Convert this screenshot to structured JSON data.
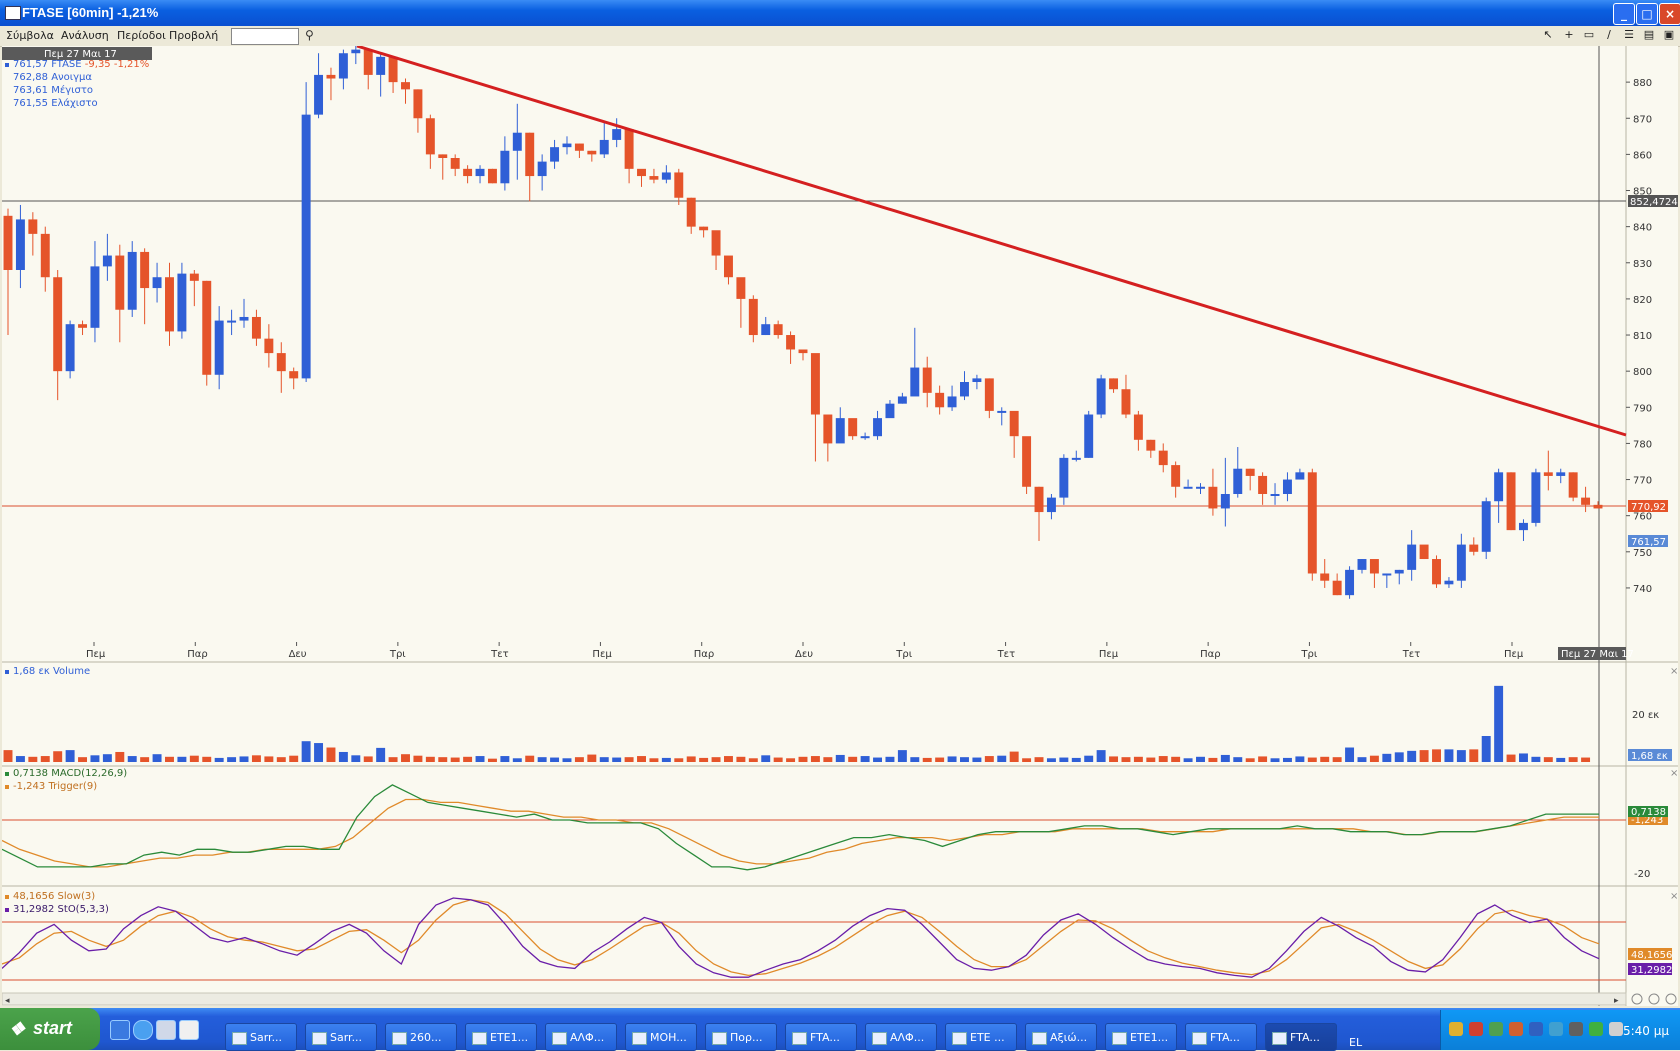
{
  "window": {
    "title": "FTASE [60min] -1,21%",
    "buttons": [
      "_",
      "□",
      "×"
    ]
  },
  "menu": {
    "items": [
      "Σύμβολα",
      "Ανάλυση",
      "Περίοδοι",
      "Προβολή"
    ],
    "search_value": ""
  },
  "toolbar": {
    "tools": [
      "arrow-icon",
      "crosshair-icon",
      "rect-icon",
      "line-icon",
      "hline-icon",
      "panel-icon",
      "save-icon"
    ]
  },
  "price_panel": {
    "date_badge": "Πεμ 27 Μαι 17",
    "info": {
      "symbol_line_value": "761,57",
      "symbol": "FTASE",
      "change": "-9,35",
      "change_pct": "-1,21%",
      "open_label": "Ανοιγμα",
      "open": "762,88",
      "high_label": "Μέγιστο",
      "high": "763,61",
      "low_label": "Ελάχιστο",
      "low": "761,55"
    },
    "y_ticks": [
      "880",
      "870",
      "860",
      "850",
      "840",
      "830",
      "820",
      "810",
      "800",
      "790",
      "780",
      "770",
      "760",
      "750",
      "740"
    ],
    "x_ticks": [
      "Πεμ",
      "Παρ",
      "Δευ",
      "Τρι",
      "Τετ",
      "Πεμ",
      "Παρ",
      "Δευ",
      "Τρι",
      "Τετ",
      "Πεμ",
      "Παρ",
      "Τρι",
      "Τετ",
      "Πεμ"
    ],
    "x_badge": "Πεμ 27 Μαι 17",
    "badges": {
      "hline_gray": "852,4724",
      "hline_red": "770,92",
      "last": "761,57"
    }
  },
  "volume_panel": {
    "label_value": "1,68 εκ",
    "label_name": "Volume",
    "y_tick": "20 εκ",
    "badge": "1,68 εκ"
  },
  "macd_panel": {
    "macd_value": "0,7138",
    "macd_name": "MACD(12,26,9)",
    "trigger_value": "-1,243",
    "trigger_name": "Trigger(9)",
    "y_tick": "-20",
    "badge_macd": "0,7138",
    "badge_trigger": "-1,243"
  },
  "stoch_panel": {
    "slow_value": "48,1656",
    "slow_name": "Slow(3)",
    "sto_value": "31,2982",
    "sto_name": "StO(5,3,3)",
    "badge_slow": "48,1656",
    "badge_sto": "31,2982"
  },
  "colors": {
    "up": "#2f5fd6",
    "down": "#e5542a",
    "trend": "#d92020",
    "macd": "#2a8a3a",
    "trigger": "#e08a2a",
    "sto": "#6a1ea8",
    "slow": "#e08a2a"
  },
  "chart_data": {
    "type": "candlestick",
    "y_range": [
      735,
      890
    ],
    "candles": [
      [
        843,
        828,
        845,
        810
      ],
      [
        828,
        842,
        846,
        823
      ],
      [
        842,
        838,
        844,
        832
      ],
      [
        838,
        826,
        840,
        822
      ],
      [
        826,
        800,
        828,
        792
      ],
      [
        800,
        813,
        814,
        798
      ],
      [
        813,
        812,
        814,
        810
      ],
      [
        812,
        829,
        836,
        808
      ],
      [
        829,
        832,
        838,
        825
      ],
      [
        832,
        817,
        835,
        808
      ],
      [
        817,
        833,
        836,
        815
      ],
      [
        833,
        823,
        834,
        813
      ],
      [
        823,
        826,
        830,
        819
      ],
      [
        826,
        811,
        830,
        807
      ],
      [
        811,
        827,
        830,
        809
      ],
      [
        827,
        825,
        828,
        818
      ],
      [
        825,
        799,
        825,
        796
      ],
      [
        799,
        814,
        818,
        795
      ],
      [
        814,
        814,
        817,
        810
      ],
      [
        814,
        815,
        820,
        812
      ],
      [
        815,
        809,
        817,
        807
      ],
      [
        809,
        805,
        813,
        801
      ],
      [
        805,
        800,
        808,
        794
      ],
      [
        800,
        798,
        801,
        795
      ],
      [
        798,
        871,
        880,
        797
      ],
      [
        871,
        882,
        888,
        870
      ],
      [
        882,
        881,
        884,
        875
      ],
      [
        881,
        888,
        889,
        878
      ],
      [
        888,
        889,
        892,
        885
      ],
      [
        889,
        882,
        889,
        878
      ],
      [
        882,
        887,
        888,
        876
      ],
      [
        887,
        880,
        886,
        877
      ],
      [
        880,
        878,
        881,
        874
      ],
      [
        878,
        870,
        878,
        866
      ],
      [
        870,
        860,
        871,
        856
      ],
      [
        860,
        859,
        860,
        853
      ],
      [
        859,
        856,
        860,
        854
      ],
      [
        856,
        854,
        857,
        852
      ],
      [
        854,
        856,
        857,
        852
      ],
      [
        856,
        852,
        856,
        852
      ],
      [
        852,
        861,
        865,
        850
      ],
      [
        861,
        866,
        874,
        853
      ],
      [
        866,
        854,
        866,
        847
      ],
      [
        854,
        858,
        860,
        850
      ],
      [
        858,
        862,
        864,
        856
      ],
      [
        862,
        863,
        865,
        860
      ],
      [
        863,
        861,
        863,
        859
      ],
      [
        861,
        860,
        861,
        858
      ],
      [
        860,
        864,
        869,
        859
      ],
      [
        864,
        867,
        870,
        862
      ],
      [
        867,
        856,
        867,
        852
      ],
      [
        856,
        854,
        855,
        851
      ],
      [
        854,
        853,
        856,
        852
      ],
      [
        853,
        855,
        857,
        852
      ],
      [
        855,
        848,
        856,
        846
      ],
      [
        848,
        840,
        848,
        838
      ],
      [
        840,
        839,
        840,
        837
      ],
      [
        839,
        832,
        833,
        828
      ],
      [
        832,
        826,
        827,
        824
      ],
      [
        826,
        820,
        821,
        812
      ],
      [
        820,
        810,
        821,
        808
      ],
      [
        810,
        813,
        815,
        810
      ],
      [
        813,
        810,
        814,
        809
      ],
      [
        810,
        806,
        811,
        802
      ],
      [
        806,
        805,
        806,
        803
      ],
      [
        805,
        788,
        789,
        775
      ],
      [
        788,
        780,
        782,
        775
      ],
      [
        780,
        787,
        790,
        781
      ],
      [
        787,
        782,
        785,
        781
      ],
      [
        782,
        782,
        783,
        781
      ],
      [
        782,
        787,
        789,
        781
      ],
      [
        787,
        791,
        792,
        788
      ],
      [
        791,
        793,
        794,
        791
      ],
      [
        793,
        801,
        812,
        799
      ],
      [
        801,
        794,
        804,
        790
      ],
      [
        794,
        790,
        796,
        788
      ],
      [
        790,
        793,
        796,
        789
      ],
      [
        793,
        797,
        800,
        792
      ],
      [
        797,
        798,
        799,
        795
      ],
      [
        798,
        789,
        798,
        787
      ],
      [
        789,
        789,
        790,
        785
      ],
      [
        789,
        782,
        782,
        776
      ],
      [
        782,
        768,
        771,
        766
      ],
      [
        768,
        761,
        768,
        753
      ],
      [
        761,
        765,
        766,
        759
      ],
      [
        765,
        776,
        777,
        763
      ],
      [
        776,
        776,
        778,
        775
      ],
      [
        776,
        788,
        789,
        776
      ],
      [
        788,
        798,
        799,
        787
      ],
      [
        798,
        795,
        798,
        794
      ],
      [
        795,
        788,
        799,
        787
      ],
      [
        788,
        781,
        789,
        778
      ],
      [
        781,
        778,
        781,
        776
      ],
      [
        778,
        774,
        780,
        772
      ],
      [
        774,
        768,
        775,
        765
      ],
      [
        768,
        768,
        770,
        768
      ],
      [
        768,
        768,
        769,
        766
      ],
      [
        768,
        762,
        773,
        760
      ],
      [
        762,
        766,
        776,
        757
      ],
      [
        766,
        773,
        779,
        765
      ],
      [
        773,
        771,
        773,
        767
      ],
      [
        771,
        766,
        772,
        763
      ],
      [
        766,
        766,
        769,
        763
      ],
      [
        766,
        770,
        772,
        764
      ],
      [
        770,
        772,
        773,
        770
      ],
      [
        772,
        744,
        773,
        742
      ],
      [
        744,
        742,
        748,
        740
      ],
      [
        742,
        738,
        744,
        738
      ],
      [
        738,
        745,
        746,
        737
      ],
      [
        745,
        748,
        748,
        744
      ],
      [
        748,
        744,
        746,
        740
      ],
      [
        744,
        744,
        744,
        740
      ],
      [
        744,
        745,
        745,
        741
      ],
      [
        745,
        752,
        756,
        742
      ],
      [
        752,
        748,
        751,
        748
      ],
      [
        748,
        741,
        749,
        740
      ],
      [
        741,
        742,
        743,
        740
      ],
      [
        742,
        752,
        755,
        740
      ],
      [
        752,
        750,
        754,
        749
      ],
      [
        750,
        764,
        765,
        748
      ],
      [
        764,
        772,
        773,
        758
      ],
      [
        772,
        756,
        772,
        756
      ],
      [
        756,
        758,
        759,
        753
      ],
      [
        758,
        772,
        773,
        757
      ],
      [
        772,
        771,
        778,
        767
      ],
      [
        771,
        772,
        773,
        769
      ],
      [
        772,
        765,
        772,
        764
      ],
      [
        765,
        763,
        768,
        761
      ],
      [
        763,
        762,
        764,
        762
      ]
    ],
    "volume": [
      3.2,
      1.6,
      1.4,
      1.6,
      2.9,
      3.2,
      1.3,
      1.8,
      2.1,
      2.7,
      1.6,
      1.3,
      2.1,
      1.4,
      1.4,
      1.7,
      1.4,
      1.1,
      1.3,
      1.5,
      1.8,
      1.5,
      1.3,
      1.7,
      5.6,
      5.1,
      3.9,
      2.7,
      1.8,
      1.5,
      3.8,
      1.3,
      2.1,
      1.7,
      1.4,
      1.3,
      1.2,
      1.4,
      1.6,
      0.9,
      1.6,
      1.0,
      1.7,
      1.3,
      1.2,
      1.0,
      1.3,
      2.0,
      1.3,
      1.2,
      1.3,
      1.6,
      1.0,
      1.1,
      1.0,
      1.5,
      1.1,
      1.3,
      1.6,
      1.4,
      1.0,
      1.8,
      1.2,
      1.0,
      1.4,
      1.6,
      1.3,
      1.9,
      1.4,
      1.6,
      1.2,
      1.4,
      3.2,
      1.3,
      1.1,
      1.2,
      1.5,
      1.3,
      1.2,
      1.6,
      1.7,
      2.8,
      1.0,
      1.3,
      1.0,
      1.2,
      1.1,
      1.7,
      3.2,
      1.5,
      1.3,
      1.4,
      1.2,
      1.6,
      1.4,
      1.0,
      1.4,
      1.1,
      1.9,
      1.3,
      1.0,
      1.5,
      1.0,
      1.1,
      1.5,
      1.2,
      1.4,
      1.3,
      3.9,
      1.3,
      1.7,
      2.2,
      2.6,
      3.0,
      3.2,
      3.4,
      3.4,
      3.2,
      3.4,
      7.0,
      20.5,
      2.0,
      2.3,
      1.4,
      1.3,
      1.1,
      1.3,
      1.2
    ],
    "macd": [
      -10,
      -13,
      -16,
      -16,
      -16,
      -16,
      -15,
      -15,
      -12,
      -11,
      -12,
      -10,
      -10,
      -11,
      -11,
      -10,
      -9,
      -9,
      -10,
      -10,
      1,
      8,
      12,
      9,
      6,
      5,
      4,
      3,
      2,
      1,
      2,
      0,
      0,
      -1,
      -1,
      -1,
      -1,
      -3,
      -8,
      -12,
      -16,
      -16,
      -17,
      -16,
      -14,
      -12,
      -10,
      -8,
      -6,
      -6,
      -5,
      -6,
      -7,
      -9,
      -7,
      -5,
      -4,
      -4,
      -4,
      -4,
      -3,
      -2,
      -2,
      -3,
      -3,
      -4,
      -5,
      -4,
      -3,
      -3,
      -3,
      -3,
      -3,
      -2,
      -3,
      -3,
      -4,
      -4,
      -4,
      -5,
      -5,
      -4,
      -4,
      -4,
      -3,
      -2,
      0,
      2,
      2,
      2,
      2
    ],
    "trigger": [
      -7,
      -10,
      -12,
      -14,
      -15,
      -16,
      -16,
      -15,
      -14,
      -13,
      -13,
      -12,
      -12,
      -11,
      -11,
      -10,
      -10,
      -10,
      -10,
      -9,
      -6,
      -1,
      4,
      7,
      7,
      6,
      6,
      5,
      4,
      3,
      3,
      2,
      1,
      1,
      0,
      0,
      -1,
      -1,
      -3,
      -6,
      -9,
      -12,
      -14,
      -15,
      -15,
      -14,
      -13,
      -11,
      -10,
      -8,
      -7,
      -6,
      -6,
      -6,
      -7,
      -6,
      -5,
      -5,
      -4,
      -4,
      -4,
      -3,
      -3,
      -3,
      -3,
      -3,
      -4,
      -4,
      -4,
      -4,
      -3,
      -3,
      -3,
      -3,
      -3,
      -3,
      -3,
      -3,
      -4,
      -4,
      -5,
      -5,
      -4,
      -4,
      -4,
      -3,
      -2,
      -1,
      0,
      1,
      1,
      1
    ],
    "sto": [
      20,
      38,
      60,
      70,
      52,
      40,
      42,
      65,
      80,
      90,
      85,
      70,
      55,
      50,
      55,
      48,
      40,
      35,
      48,
      62,
      70,
      60,
      40,
      25,
      70,
      92,
      100,
      98,
      92,
      70,
      45,
      28,
      22,
      20,
      38,
      50,
      65,
      78,
      72,
      45,
      25,
      15,
      10,
      10,
      18,
      25,
      30,
      40,
      52,
      68,
      80,
      88,
      86,
      70,
      50,
      30,
      20,
      18,
      22,
      35,
      58,
      75,
      82,
      70,
      55,
      42,
      30,
      25,
      22,
      20,
      15,
      12,
      10,
      20,
      40,
      62,
      78,
      68,
      55,
      45,
      28,
      18,
      16,
      30,
      55,
      82,
      92,
      80,
      72,
      76,
      55,
      40,
      31
    ],
    "slow": [
      25,
      32,
      48,
      60,
      62,
      52,
      45,
      52,
      68,
      80,
      85,
      78,
      65,
      56,
      52,
      50,
      45,
      40,
      42,
      52,
      62,
      64,
      52,
      38,
      52,
      75,
      92,
      98,
      95,
      82,
      62,
      42,
      30,
      24,
      30,
      42,
      55,
      68,
      72,
      60,
      40,
      25,
      16,
      12,
      14,
      20,
      26,
      34,
      44,
      57,
      70,
      80,
      85,
      78,
      62,
      45,
      30,
      22,
      22,
      30,
      46,
      62,
      75,
      74,
      65,
      52,
      40,
      32,
      26,
      22,
      18,
      15,
      13,
      17,
      30,
      48,
      66,
      70,
      62,
      52,
      40,
      28,
      20,
      24,
      42,
      65,
      82,
      86,
      80,
      76,
      68,
      55,
      48
    ]
  }
}
